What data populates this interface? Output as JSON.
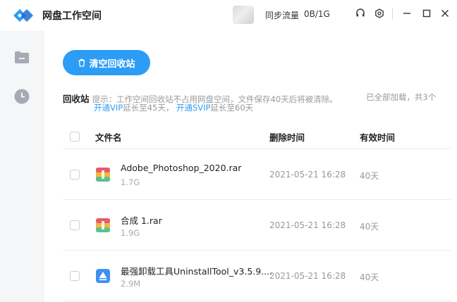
{
  "titlebar": {
    "app_title": "网盘工作空间",
    "traffic_label": "同步流量",
    "traffic_value": "0B/1G",
    "icons": [
      "headset-icon",
      "settings-icon",
      "minimize-icon",
      "maximize-icon",
      "close-icon"
    ]
  },
  "sidebar": {
    "items": [
      {
        "icon": "folder-icon"
      },
      {
        "icon": "clock-icon"
      }
    ]
  },
  "toolbar": {
    "clear_label": "清空回收站"
  },
  "info": {
    "title": "回收站",
    "tip": "提示：工作空间回收站不占用网盘空间，文件保存40天后将被清除。",
    "loaded": "已全部加载，共3个",
    "vip_link": "开通VIP",
    "vip_text": "延长至45天，",
    "svip_link": "开通SVIP",
    "svip_text": "延长至60天"
  },
  "table": {
    "headers": [
      "文件名",
      "删除时间",
      "有效时间"
    ],
    "rows": [
      {
        "name": "Adobe_Photoshop_2020.rar",
        "size": "1.7G",
        "deleted": "2021-05-21 16:28",
        "valid": "40天",
        "icon": "archive-icon"
      },
      {
        "name": "合成 1.rar",
        "size": "1.9G",
        "deleted": "2021-05-21 16:28",
        "valid": "40天",
        "icon": "archive-icon"
      },
      {
        "name": "最强卸载工具UninstallTool_v3.5.9....",
        "size": "2.9M",
        "deleted": "2021-05-21 16:28",
        "valid": "40天",
        "icon": "app-file-icon"
      }
    ]
  },
  "colors": {
    "accent": "#2d9cf5",
    "sidebar_bg": "#f5f6f8"
  }
}
